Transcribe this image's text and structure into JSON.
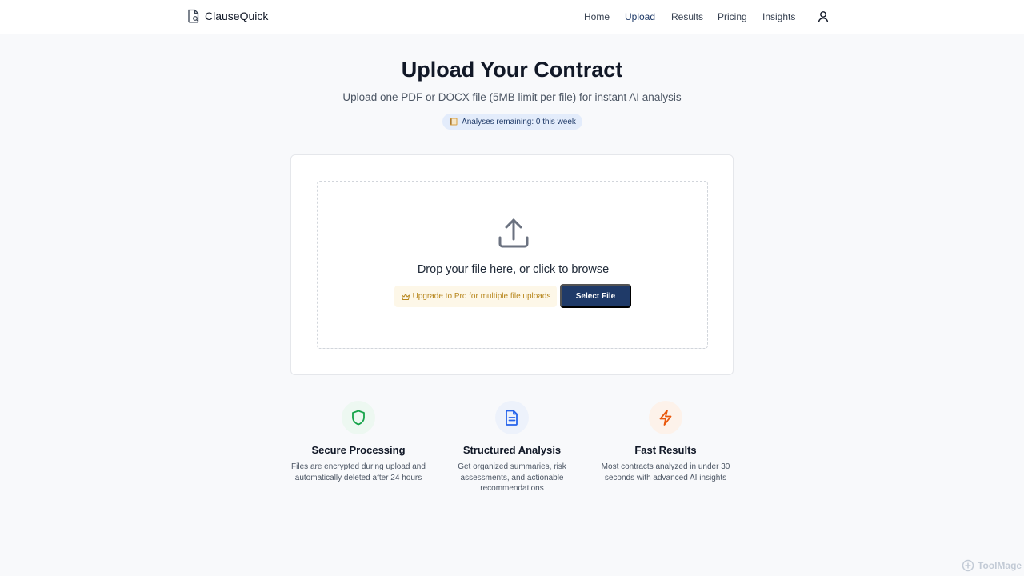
{
  "header": {
    "brand": "ClauseQuick",
    "nav": [
      "Home",
      "Upload",
      "Results",
      "Pricing",
      "Insights"
    ],
    "active_nav": "Upload"
  },
  "main": {
    "title": "Upload Your Contract",
    "subtitle": "Upload one PDF or DOCX file (5MB limit per file) for instant AI analysis",
    "quota": "Analyses remaining: 0 this week"
  },
  "upload": {
    "drop_text": "Drop your file here, or click to browse",
    "upgrade_note": "Upgrade to Pro for multiple file uploads",
    "select_label": "Select File"
  },
  "features": [
    {
      "title": "Secure Processing",
      "description": "Files are encrypted during upload and automatically deleted after 24 hours",
      "icon": "shield-icon",
      "color": "#16a34a"
    },
    {
      "title": "Structured Analysis",
      "description": "Get organized summaries, risk assessments, and actionable recommendations",
      "icon": "document-icon",
      "color": "#2563eb"
    },
    {
      "title": "Fast Results",
      "description": "Most contracts analyzed in under 30 seconds with advanced AI insights",
      "icon": "lightning-icon",
      "color": "#ea580c"
    }
  ],
  "watermark": "ToolMage",
  "colors": {
    "primary": "#1f3a68",
    "badge_bg": "#e3ecfb",
    "upgrade_bg": "#fdf7e8",
    "upgrade_text": "#b7861c"
  }
}
